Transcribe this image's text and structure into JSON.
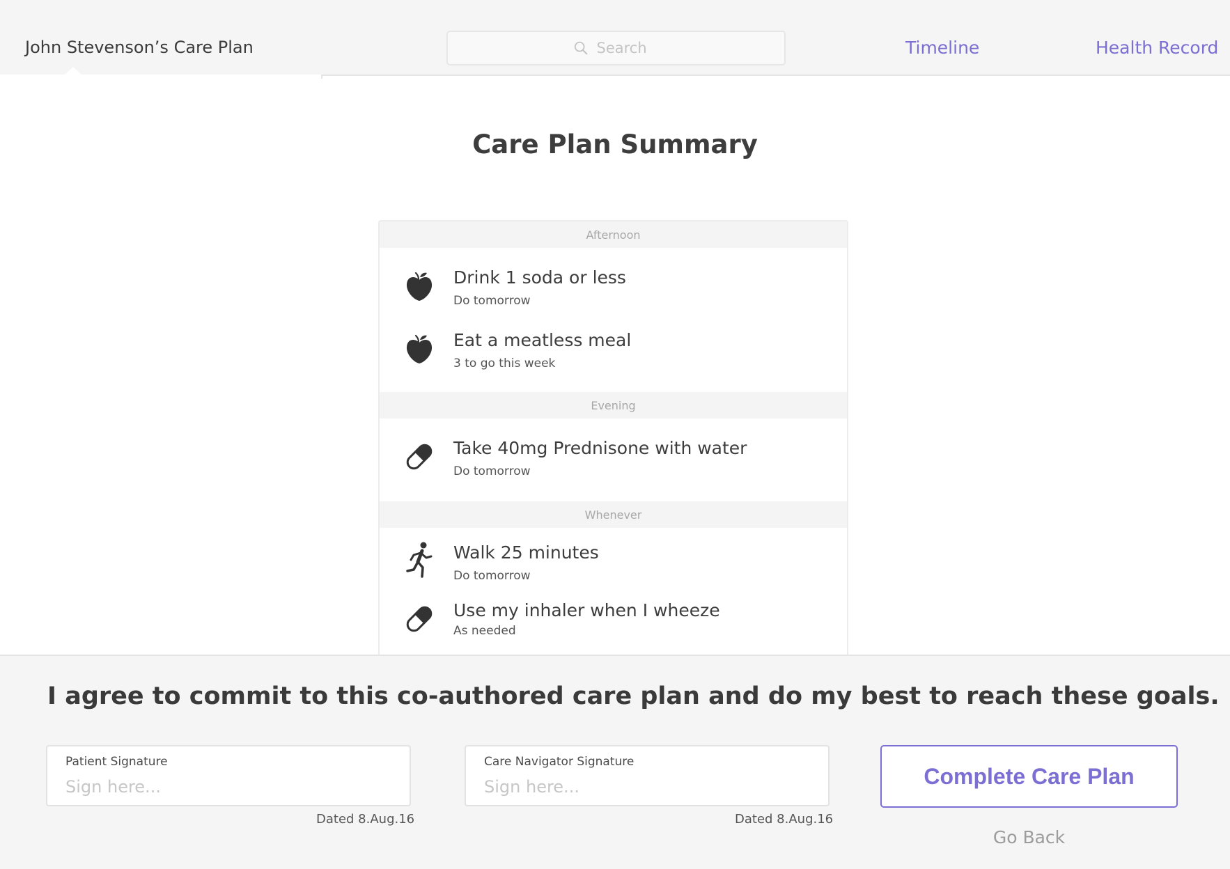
{
  "header": {
    "title": "John Stevenson’s Care Plan",
    "search_placeholder": "Search",
    "nav": {
      "timeline": "Timeline",
      "health_record": "Health Record"
    }
  },
  "summary": {
    "title": "Care Plan Summary",
    "sections": [
      {
        "label": "Afternoon",
        "tasks": [
          {
            "icon": "apple-icon",
            "title": "Drink 1 soda or less",
            "subtitle": "Do tomorrow"
          },
          {
            "icon": "apple-icon",
            "title": "Eat a meatless meal",
            "subtitle": "3 to go this week"
          }
        ]
      },
      {
        "label": "Evening",
        "tasks": [
          {
            "icon": "pill-icon",
            "title": "Take 40mg Prednisone with water",
            "subtitle": "Do tomorrow"
          }
        ]
      },
      {
        "label": "Whenever",
        "tasks": [
          {
            "icon": "walking-person-icon",
            "title": "Walk 25 minutes",
            "subtitle": "Do tomorrow"
          },
          {
            "icon": "pill-icon",
            "title": "Use my inhaler when I wheeze",
            "subtitle": "As needed"
          }
        ]
      }
    ]
  },
  "agreement": {
    "statement": "I agree to commit to this co-authored care plan and do my best to reach these goals.",
    "patient_signature": {
      "label": "Patient Signature",
      "placeholder": "Sign here...",
      "date": "Dated 8.Aug.16"
    },
    "navigator_signature": {
      "label": "Care Navigator Signature",
      "placeholder": "Sign here...",
      "date": "Dated 8.Aug.16"
    },
    "complete_label": "Complete Care Plan",
    "go_back_label": "Go Back"
  },
  "colors": {
    "accent": "#7b6fd3",
    "panel_background": "#f5f5f5",
    "text": "#3d3d3d"
  }
}
